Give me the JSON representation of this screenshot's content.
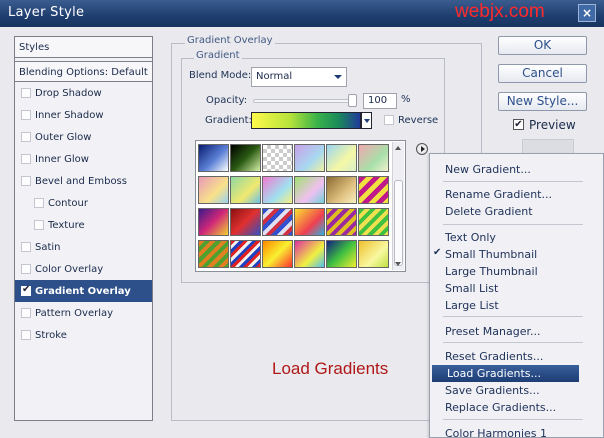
{
  "window": {
    "title": "Layer Style",
    "watermark": "webjx.com",
    "close": "×"
  },
  "styles_panel": {
    "header": "Styles",
    "blending_options": "Blending Options: Default",
    "items": [
      {
        "label": "Drop Shadow",
        "checked": false,
        "indent": false
      },
      {
        "label": "Inner Shadow",
        "checked": false,
        "indent": false
      },
      {
        "label": "Outer Glow",
        "checked": false,
        "indent": false
      },
      {
        "label": "Inner Glow",
        "checked": false,
        "indent": false
      },
      {
        "label": "Bevel and Emboss",
        "checked": false,
        "indent": false
      },
      {
        "label": "Contour",
        "checked": false,
        "indent": true
      },
      {
        "label": "Texture",
        "checked": false,
        "indent": true
      },
      {
        "label": "Satin",
        "checked": false,
        "indent": false
      },
      {
        "label": "Color Overlay",
        "checked": false,
        "indent": false
      },
      {
        "label": "Gradient Overlay",
        "checked": true,
        "indent": false,
        "selected": true
      },
      {
        "label": "Pattern Overlay",
        "checked": false,
        "indent": false
      },
      {
        "label": "Stroke",
        "checked": false,
        "indent": false
      }
    ]
  },
  "gradient_overlay": {
    "group_title": "Gradient Overlay",
    "subgroup_title": "Gradient",
    "blend_mode_label": "Blend Mode:",
    "blend_mode_value": "Normal",
    "opacity_label": "Opacity:",
    "opacity_value": "100",
    "opacity_unit": "%",
    "opacity_level": 1.0,
    "gradient_label": "Gradient:",
    "reverse_label": "Reverse"
  },
  "annotation": "Load Gradients",
  "buttons": {
    "ok": "OK",
    "cancel": "Cancel",
    "new_style": "New Style...",
    "preview": "Preview"
  },
  "context_menu": {
    "items": [
      "New Gradient...",
      "Rename Gradient...",
      "Delete Gradient",
      "Text Only",
      "Small Thumbnail",
      "Large Thumbnail",
      "Small List",
      "Large List",
      "Preset Manager...",
      "Reset Gradients...",
      "Load Gradients...",
      "Save Gradients...",
      "Replace Gradients...",
      "Color Harmonies 1"
    ],
    "checked_item": "Small Thumbnail",
    "highlighted_item": "Load Gradients..."
  },
  "colors": {
    "title_bar": "#1f3e70",
    "selection": "#2d4f8a",
    "annotation": "#b01818",
    "watermark": "#ff2a2a"
  }
}
